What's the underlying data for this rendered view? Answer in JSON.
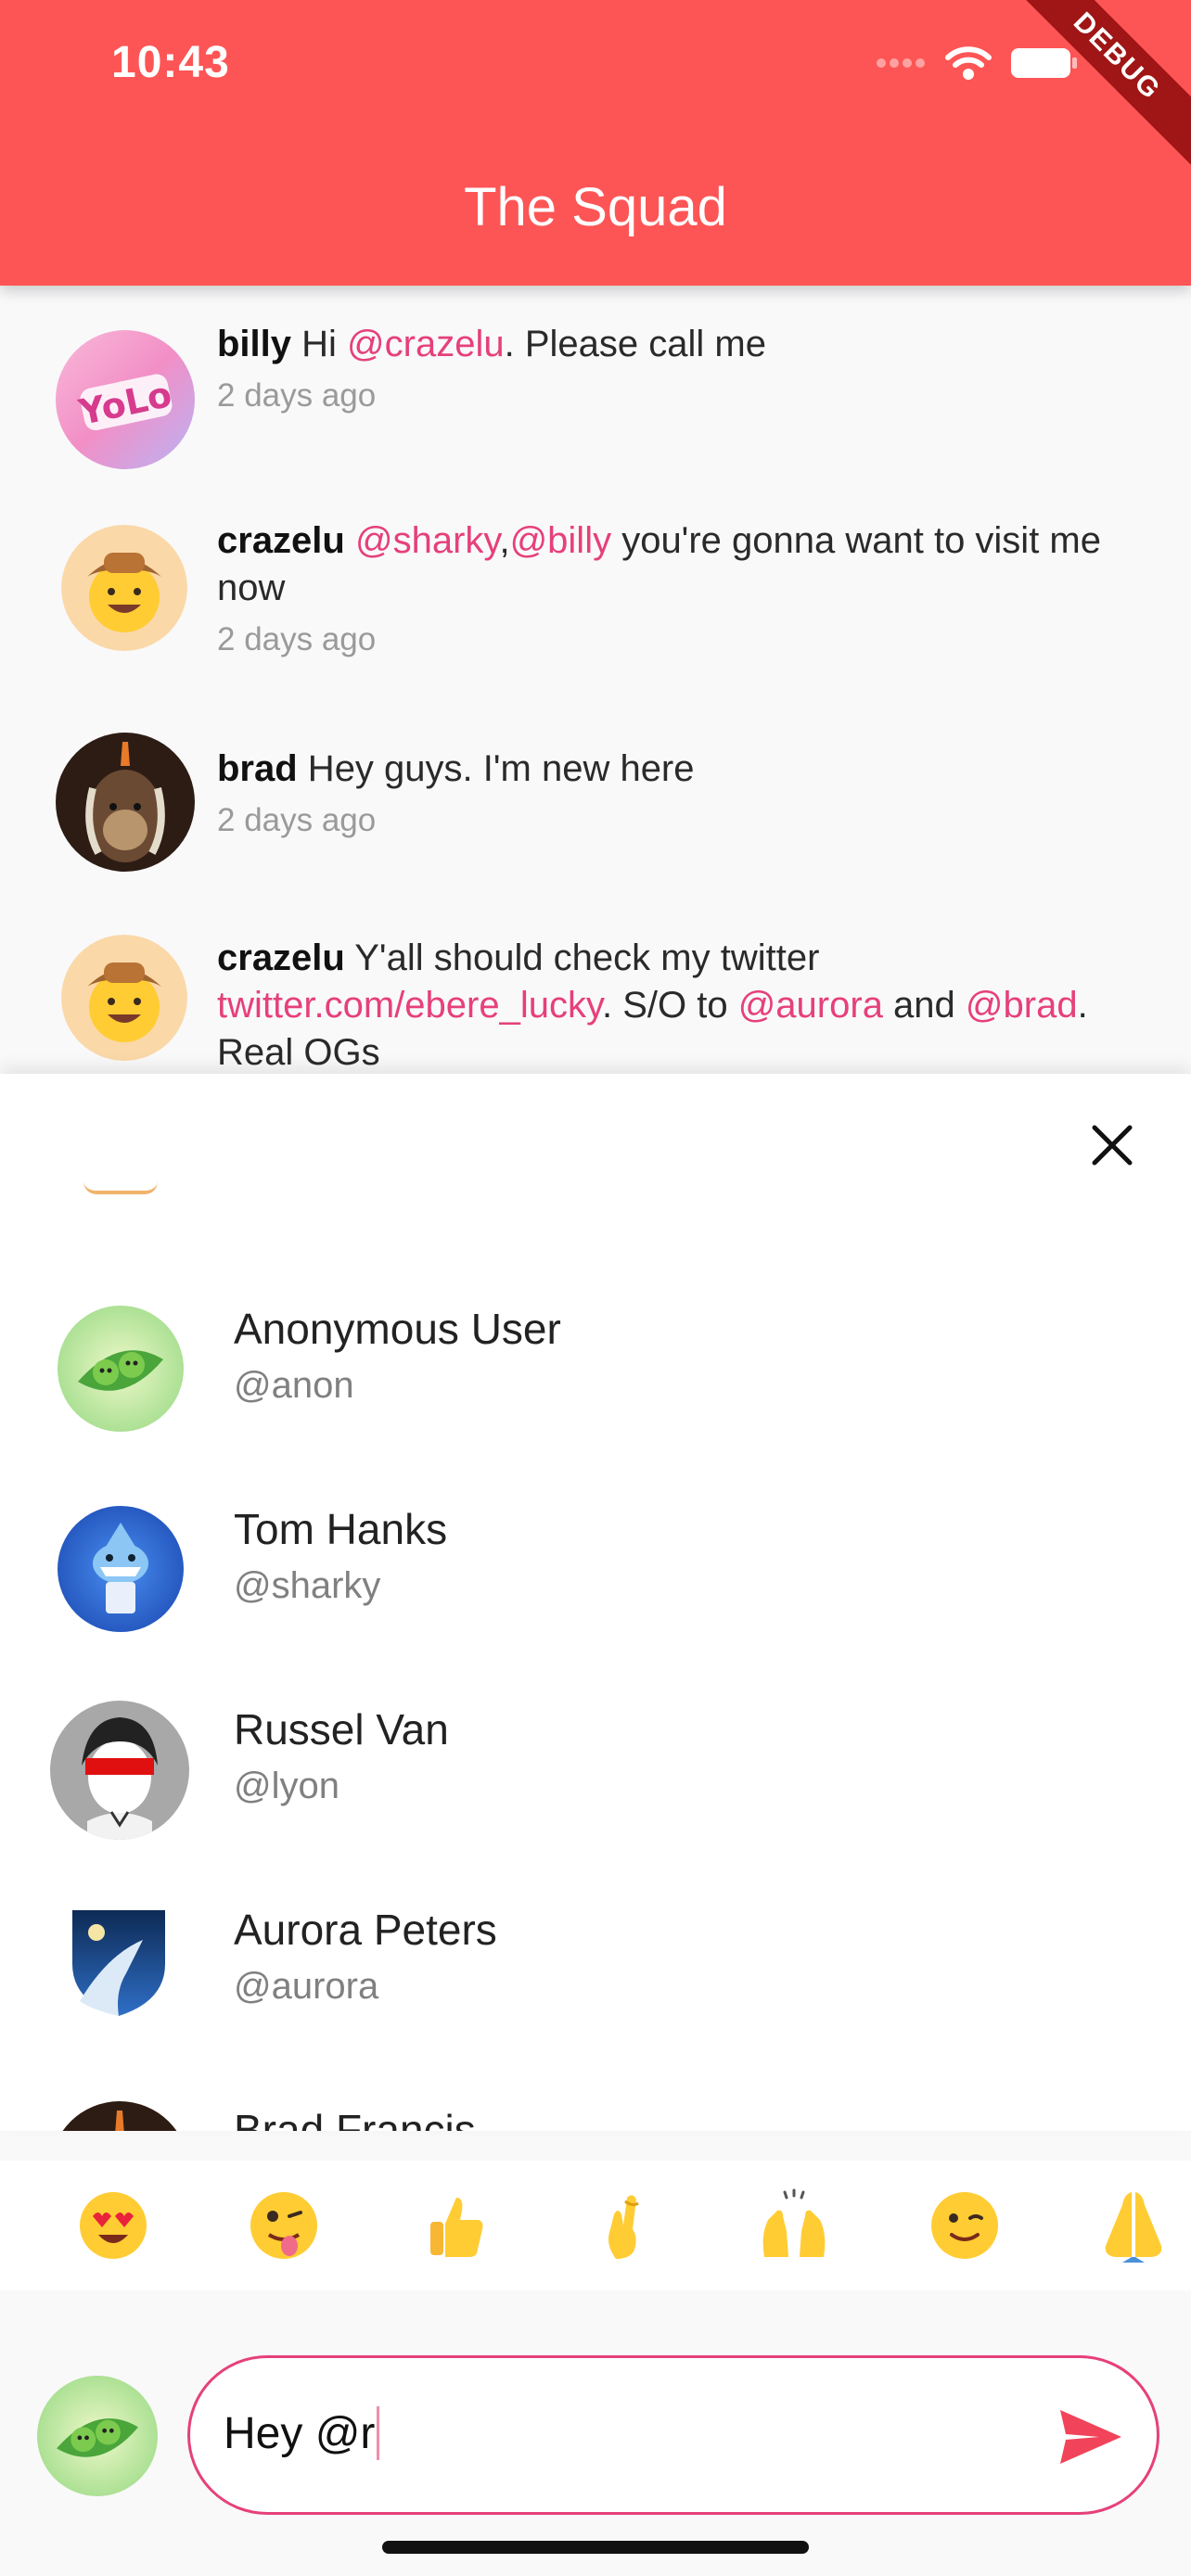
{
  "status_bar": {
    "time": "10:43"
  },
  "debug_banner": "DEBUG",
  "header": {
    "title": "The Squad"
  },
  "messages": [
    {
      "username": "billy",
      "part1": " Hi ",
      "mention1": "@crazelu",
      "part2": ". Please call me",
      "time": "2 days ago"
    },
    {
      "username": "crazelu",
      "part1": " ",
      "mention1": "@sharky",
      "sep": ",",
      "mention2": "@billy",
      "part2": " you're gonna want to visit me now",
      "time": "2 days ago"
    },
    {
      "username": "brad",
      "part1": " Hey guys. I'm new here",
      "time": "2 days ago"
    },
    {
      "username": "crazelu",
      "part1": " Y'all should check my twitter ",
      "link": "twitter.com/ebere_lucky",
      "part2": ". S/O to ",
      "mention1": "@aurora",
      "part3": " and ",
      "mention2": "@brad",
      "part4": ". Real OGs"
    }
  ],
  "suggestions": [
    {
      "name": "Anonymous User",
      "handle": "@anon"
    },
    {
      "name": "Tom Hanks",
      "handle": "@sharky"
    },
    {
      "name": "Russel Van",
      "handle": "@lyon"
    },
    {
      "name": "Aurora Peters",
      "handle": "@aurora"
    },
    {
      "name": "Brad Francis"
    }
  ],
  "emojis": [
    "heart-eyes",
    "zany-tongue",
    "thumbs-up",
    "crossed-fingers",
    "raised-hands",
    "winking",
    "folded-hands"
  ],
  "composer": {
    "text": "Hey @r"
  },
  "colors": {
    "app_bar": "#fd5555",
    "mention": "#e6407a",
    "send": "#f1435a",
    "time_text": "#9a9a9a"
  }
}
